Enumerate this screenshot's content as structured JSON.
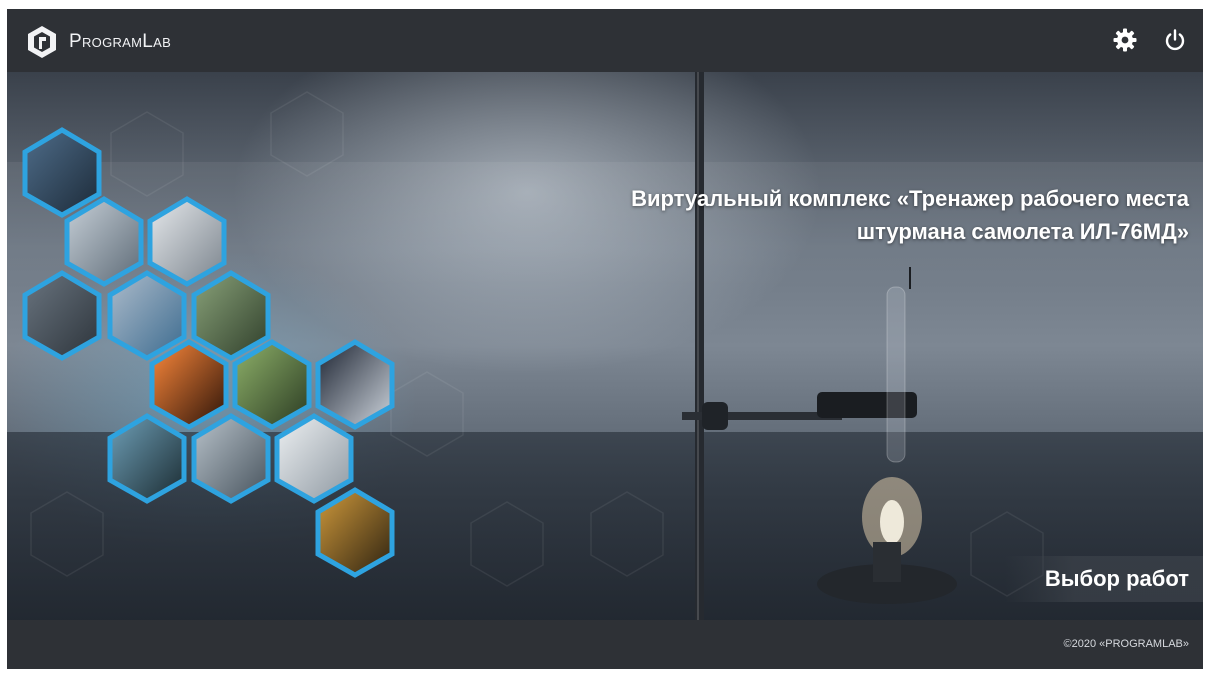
{
  "header": {
    "brand": "ProgramLab",
    "icons": [
      "logo-icon",
      "settings-gear-icon",
      "power-icon"
    ]
  },
  "main": {
    "title_line1": "Виртуальный комплекс «Тренажер рабочего места",
    "title_line2": "штурмана самолета ИЛ-76МД»",
    "select_button": "Выбор работ",
    "thumbnails": [
      "control-desk-thumbnail",
      "lab-stand-thumbnail",
      "conveyor-model-thumbnail",
      "workstation-thumbnail",
      "lab-room-thumbnail",
      "pump-jack-thumbnail",
      "furnace-thumbnail",
      "substation-thumbnail",
      "rocket-engines-thumbnail",
      "tanker-ship-thumbnail",
      "building-frame-thumbnail",
      "equipment-rack-thumbnail",
      "mining-machine-thumbnail"
    ]
  },
  "footer": {
    "copyright": "©2020 «PROGRAMLAB»"
  },
  "colors": {
    "bar": "#2e3136",
    "hex_border": "#2ea3e0",
    "text": "#ffffff"
  }
}
